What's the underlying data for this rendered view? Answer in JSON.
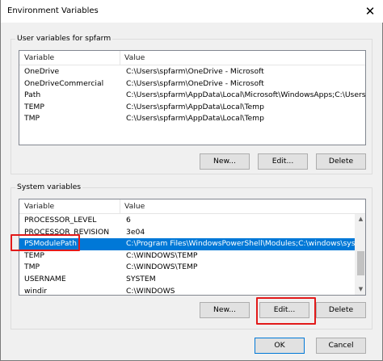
{
  "window": {
    "title": "Environment Variables",
    "close_glyph": "✕"
  },
  "user_vars": {
    "group_label": "User variables for spfarm",
    "columns": [
      "Variable",
      "Value"
    ],
    "rows": [
      {
        "name": "OneDrive",
        "value": "C:\\Users\\spfarm\\OneDrive - Microsoft"
      },
      {
        "name": "OneDriveCommercial",
        "value": "C:\\Users\\spfarm\\OneDrive - Microsoft"
      },
      {
        "name": "Path",
        "value": "C:\\Users\\spfarm\\AppData\\Local\\Microsoft\\WindowsApps;C:\\Users..."
      },
      {
        "name": "TEMP",
        "value": "C:\\Users\\spfarm\\AppData\\Local\\Temp"
      },
      {
        "name": "TMP",
        "value": "C:\\Users\\spfarm\\AppData\\Local\\Temp"
      }
    ],
    "buttons": {
      "new": "New...",
      "edit": "Edit...",
      "delete": "Delete"
    }
  },
  "system_vars": {
    "group_label": "System variables",
    "columns": [
      "Variable",
      "Value"
    ],
    "rows": [
      {
        "name": "PROCESSOR_LEVEL",
        "value": "6"
      },
      {
        "name": "PROCESSOR_REVISION",
        "value": "3e04"
      },
      {
        "name": "PSModulePath",
        "value": "C:\\Program Files\\WindowsPowerShell\\Modules;C:\\windows\\syste..."
      },
      {
        "name": "TEMP",
        "value": "C:\\WINDOWS\\TEMP"
      },
      {
        "name": "TMP",
        "value": "C:\\WINDOWS\\TEMP"
      },
      {
        "name": "USERNAME",
        "value": "SYSTEM"
      },
      {
        "name": "windir",
        "value": "C:\\WINDOWS"
      }
    ],
    "selected_index": 2,
    "buttons": {
      "new": "New...",
      "edit": "Edit...",
      "delete": "Delete"
    }
  },
  "dialog_buttons": {
    "ok": "OK",
    "cancel": "Cancel"
  },
  "icons": {
    "scroll_up": "up-arrow-icon",
    "scroll_down": "down-arrow-icon"
  },
  "colors": {
    "selection": "#0078d7",
    "highlight_box": "#e21a1a"
  }
}
